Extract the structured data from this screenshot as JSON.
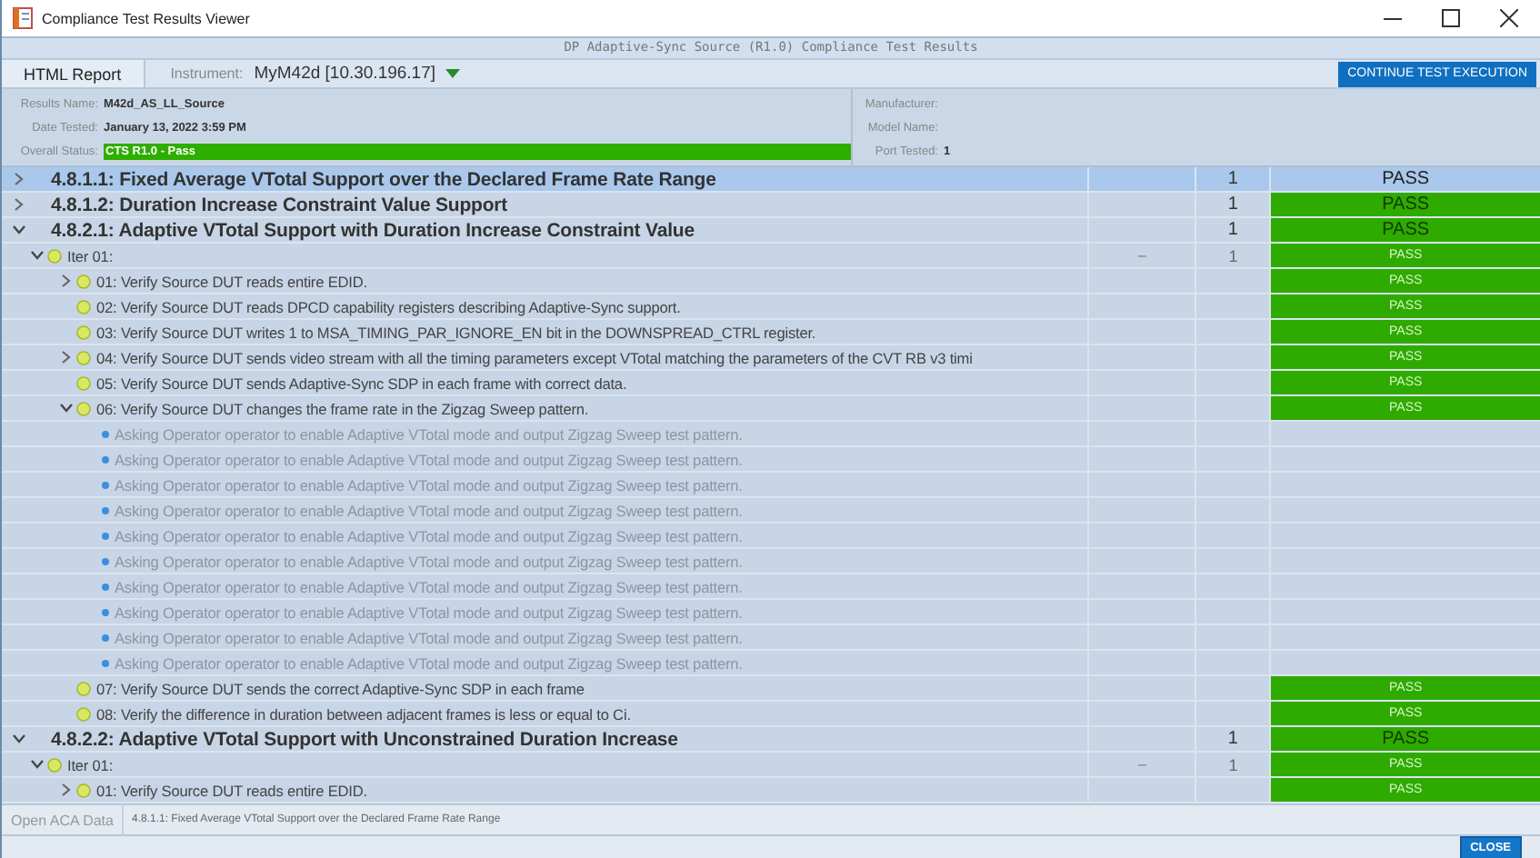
{
  "window": {
    "title": "Compliance Test Results Viewer"
  },
  "report_title": "DP Adaptive-Sync Source (R1.0) Compliance Test Results",
  "toolbar": {
    "tab": "HTML Report",
    "instrument_label": "Instrument:",
    "instrument": "MyM42d [10.30.196.17]",
    "continue_button": "CONTINUE TEST EXECUTION"
  },
  "info": {
    "left": [
      {
        "label": "Results Name:",
        "value": "M42d_AS_LL_Source",
        "kind": "text"
      },
      {
        "label": "Date Tested:",
        "value": "January 13, 2022 3:59 PM",
        "kind": "text"
      },
      {
        "label": "Overall Status:",
        "value": "CTS R1.0 - Pass",
        "kind": "status"
      }
    ],
    "right": [
      {
        "label": "Manufacturer:"
      },
      {
        "label": "Model Name:"
      },
      {
        "label": "Port Tested:",
        "value": "1"
      }
    ]
  },
  "tree": [
    {
      "kind": "test",
      "label": "4.8.1.1: Fixed Average VTotal Support over the Declared Frame Rate Range",
      "expanded": false,
      "selected": true,
      "count": "1",
      "result": "PASS",
      "passed": true
    },
    {
      "kind": "test",
      "label": "4.8.1.2: Duration Increase Constraint Value Support",
      "expanded": false,
      "selected": false,
      "count": "1",
      "result": "PASS",
      "passed": true
    },
    {
      "kind": "test",
      "label": "4.8.2.1: Adaptive VTotal Support with Duration Increase Constraint Value",
      "expanded": true,
      "selected": false,
      "count": "1",
      "result": "PASS",
      "passed": true,
      "children": [
        {
          "kind": "iter",
          "label": "Iter 01:",
          "expanded": true,
          "dash": "–",
          "count": "1",
          "result": "PASS",
          "passed": true,
          "children": [
            {
              "kind": "step",
              "label": "01: Verify Source DUT reads entire EDID.",
              "expanded": false,
              "result": "PASS",
              "passed": true
            },
            {
              "kind": "step",
              "label": "02: Verify Source DUT reads DPCD capability registers describing Adaptive-Sync support.",
              "result": "PASS",
              "passed": true
            },
            {
              "kind": "step",
              "label": "03: Verify Source DUT writes 1 to MSA_TIMING_PAR_IGNORE_EN bit in the DOWNSPREAD_CTRL register.",
              "result": "PASS",
              "passed": true
            },
            {
              "kind": "step",
              "label": "04: Verify Source DUT sends video stream with all the timing parameters except VTotal matching the parameters of the CVT RB v3 timi",
              "expanded": false,
              "result": "PASS",
              "passed": true
            },
            {
              "kind": "step",
              "label": "05: Verify Source DUT sends Adaptive-Sync SDP in each frame with correct data.",
              "result": "PASS",
              "passed": true
            },
            {
              "kind": "step",
              "label": "06: Verify Source DUT changes the frame rate in the Zigzag Sweep pattern.",
              "expanded": true,
              "result": "PASS",
              "passed": true,
              "children": [
                {
                  "kind": "note",
                  "label": "Asking Operator operator to enable Adaptive VTotal mode and output Zigzag Sweep test pattern."
                },
                {
                  "kind": "note",
                  "label": "Asking Operator operator to enable Adaptive VTotal mode and output Zigzag Sweep test pattern."
                },
                {
                  "kind": "note",
                  "label": "Asking Operator operator to enable Adaptive VTotal mode and output Zigzag Sweep test pattern."
                },
                {
                  "kind": "note",
                  "label": "Asking Operator operator to enable Adaptive VTotal mode and output Zigzag Sweep test pattern."
                },
                {
                  "kind": "note",
                  "label": "Asking Operator operator to enable Adaptive VTotal mode and output Zigzag Sweep test pattern."
                },
                {
                  "kind": "note",
                  "label": "Asking Operator operator to enable Adaptive VTotal mode and output Zigzag Sweep test pattern."
                },
                {
                  "kind": "note",
                  "label": "Asking Operator operator to enable Adaptive VTotal mode and output Zigzag Sweep test pattern."
                },
                {
                  "kind": "note",
                  "label": "Asking Operator operator to enable Adaptive VTotal mode and output Zigzag Sweep test pattern."
                },
                {
                  "kind": "note",
                  "label": "Asking Operator operator to enable Adaptive VTotal mode and output Zigzag Sweep test pattern."
                },
                {
                  "kind": "note",
                  "label": "Asking Operator operator to enable Adaptive VTotal mode and output Zigzag Sweep test pattern."
                }
              ]
            },
            {
              "kind": "step",
              "label": "07: Verify Source DUT sends the correct Adaptive-Sync SDP in each frame",
              "result": "PASS",
              "passed": true
            },
            {
              "kind": "step",
              "label": "08: Verify the difference in duration between adjacent frames is less or equal to Ci.",
              "result": "PASS",
              "passed": true
            }
          ]
        }
      ]
    },
    {
      "kind": "test",
      "label": "4.8.2.2: Adaptive VTotal Support with Unconstrained Duration Increase",
      "expanded": true,
      "selected": false,
      "count": "1",
      "result": "PASS",
      "passed": true,
      "children": [
        {
          "kind": "iter",
          "label": "Iter 01:",
          "expanded": true,
          "dash": "–",
          "count": "1",
          "result": "PASS",
          "passed": true,
          "children": [
            {
              "kind": "step",
              "label": "01: Verify Source DUT reads entire EDID.",
              "expanded": false,
              "result": "PASS",
              "passed": true
            }
          ]
        }
      ]
    }
  ],
  "bottom": {
    "button": "Open ACA Data",
    "path": "4.8.1.1: Fixed Average VTotal Support over the Declared Frame Rate Range"
  },
  "close_button": "CLOSE"
}
